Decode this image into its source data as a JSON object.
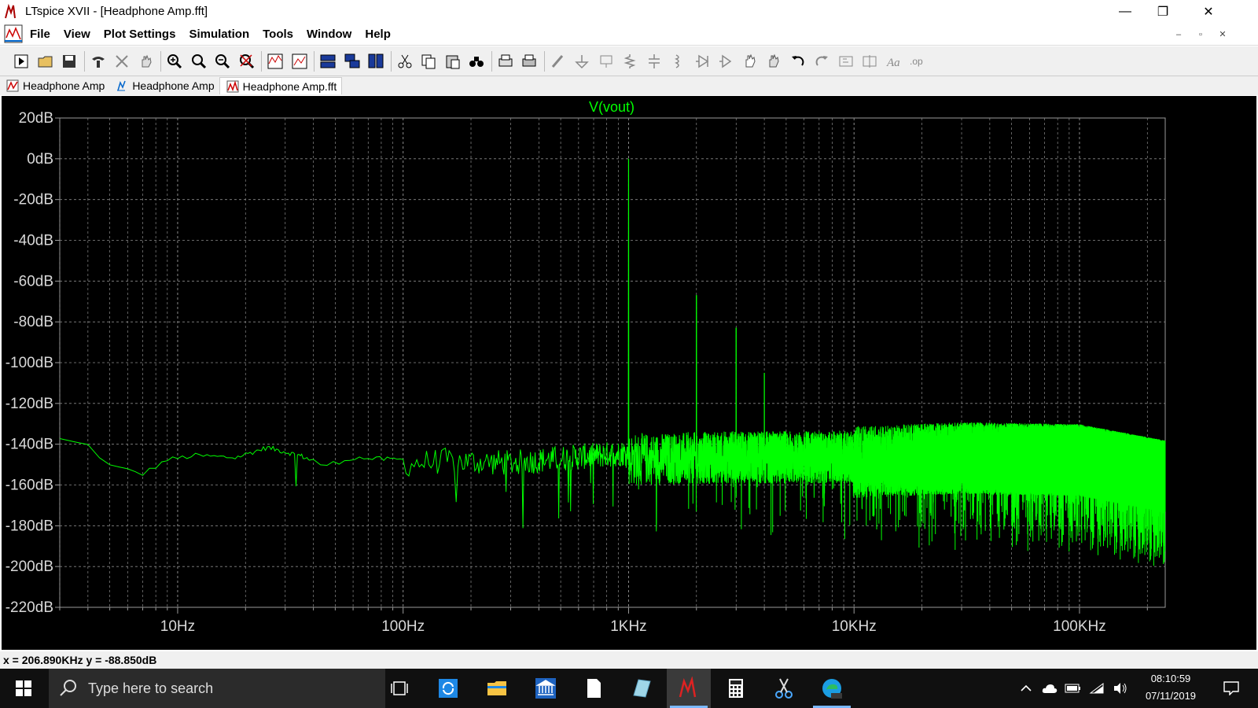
{
  "window": {
    "title": "LTspice XVII - [Headphone Amp.fft]",
    "minimize_glyph": "—",
    "maximize_glyph": "❐",
    "close_glyph": "✕"
  },
  "menu": {
    "items": [
      "File",
      "View",
      "Plot Settings",
      "Simulation",
      "Tools",
      "Window",
      "Help"
    ]
  },
  "mdi_controls": [
    "–",
    "▫",
    "✕"
  ],
  "toolbar": {
    "icons": [
      "run-icon",
      "open-icon",
      "save-icon",
      "control-panel-icon",
      "halt-icon",
      "pan-hand-icon",
      "zoom-in-icon",
      "zoom-area-icon",
      "zoom-out-icon",
      "zoom-cancel-icon",
      "autorange-icon",
      "zoom-extents-icon",
      "tile-horizontal-icon",
      "cascade-icon",
      "tile-vertical-icon",
      "cut-icon",
      "copy-icon",
      "paste-icon",
      "find-icon",
      "print-icon",
      "print-setup-icon",
      "wire-icon",
      "ground-icon",
      "label-net-icon",
      "resistor-icon",
      "capacitor-icon",
      "inductor-icon",
      "diode-icon",
      "component-icon",
      "move-icon",
      "drag-icon",
      "undo-icon",
      "redo-icon",
      "rotate-icon",
      "mirror-icon",
      "text-icon",
      "spice-directive-icon"
    ]
  },
  "tabs": [
    {
      "label": "Headphone Amp",
      "icon": "schematic-icon",
      "active": false
    },
    {
      "label": "Headphone Amp",
      "icon": "waveform-icon",
      "active": false
    },
    {
      "label": "Headphone Amp.fft",
      "icon": "fft-icon",
      "active": true
    }
  ],
  "chart_data": {
    "type": "line",
    "title": "V(vout)",
    "xscale": "log",
    "xlim": [
      3,
      240000
    ],
    "ylim": [
      -220,
      20
    ],
    "x_ticks": [
      "10Hz",
      "100Hz",
      "1KHz",
      "10KHz",
      "100KHz"
    ],
    "y_ticks": [
      "20dB",
      "0dB",
      "-20dB",
      "-40dB",
      "-60dB",
      "-80dB",
      "-100dB",
      "-120dB",
      "-140dB",
      "-160dB",
      "-180dB",
      "-200dB",
      "-220dB"
    ],
    "grid": true,
    "series": [
      {
        "name": "V(vout)",
        "color": "#00ff00",
        "noise_floor_points": [
          [
            3,
            -137
          ],
          [
            4,
            -140
          ],
          [
            5,
            -150
          ],
          [
            7,
            -154
          ],
          [
            9,
            -147
          ],
          [
            12,
            -145
          ],
          [
            18,
            -146
          ],
          [
            25,
            -141
          ],
          [
            35,
            -145
          ],
          [
            45,
            -150
          ],
          [
            60,
            -146
          ],
          [
            90,
            -147
          ],
          [
            150,
            -145
          ],
          [
            300,
            -146
          ],
          [
            600,
            -143
          ],
          [
            1000,
            -141
          ],
          [
            3000,
            -140
          ],
          [
            10000,
            -140
          ],
          [
            30000,
            -138
          ],
          [
            100000,
            -139
          ],
          [
            240000,
            -147
          ]
        ],
        "peaks": [
          [
            1000,
            0
          ],
          [
            2000,
            -67
          ],
          [
            3000,
            -83
          ],
          [
            4000,
            -105
          ]
        ]
      }
    ]
  },
  "status": {
    "readout": "x = 206.890KHz    y = -88.850dB"
  },
  "taskbar": {
    "search_placeholder": "Type here to search",
    "time": "08:10:59",
    "date": "07/11/2019",
    "apps": [
      "task-view-icon",
      "update-icon",
      "file-explorer-icon",
      "bank-icon",
      "document-icon",
      "notes-icon",
      "ltspice-icon",
      "calculator-icon",
      "snipping-tool-icon",
      "edge-dev-icon"
    ]
  }
}
